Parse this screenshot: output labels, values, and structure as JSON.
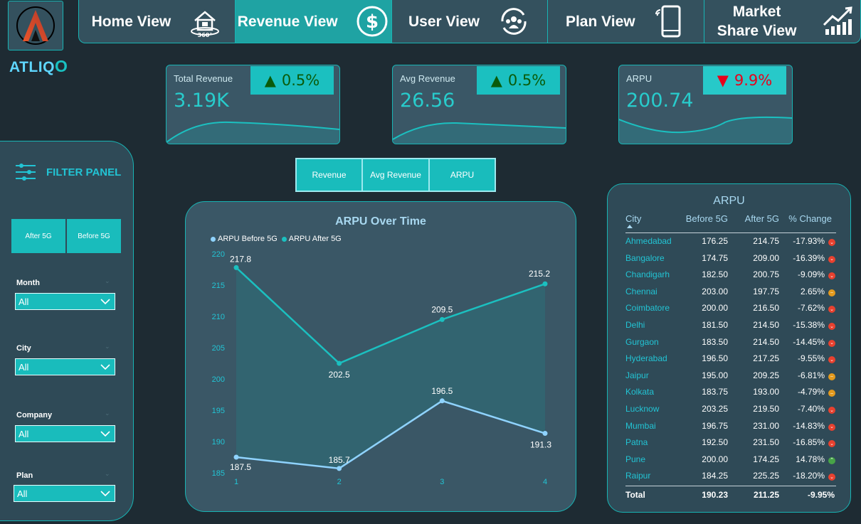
{
  "brand": {
    "name_prefix": "ATLIQ",
    "name_suffix": "O",
    "logo_letter": "A"
  },
  "nav": {
    "tabs": [
      {
        "label": "Home View",
        "icon": "house-360-icon",
        "active": false
      },
      {
        "label": "Revenue View",
        "icon": "dollar-icon",
        "active": true
      },
      {
        "label": "User View",
        "icon": "users-cycle-icon",
        "active": false
      },
      {
        "label": "Plan View",
        "icon": "smartphone-icon",
        "active": false
      },
      {
        "label": "Market Share View",
        "icon": "growth-chart-icon",
        "active": false
      }
    ]
  },
  "kpis": [
    {
      "title": "Total Revenue",
      "value": "3.19K",
      "change": "0.5%",
      "direction": "up"
    },
    {
      "title": "Avg Revenue",
      "value": "26.56",
      "change": "0.5%",
      "direction": "up"
    },
    {
      "title": "ARPU",
      "value": "200.74",
      "change": "9.9%",
      "direction": "down"
    }
  ],
  "colors": {
    "accent": "#19bcbc",
    "teal_line": "#1bc0c0",
    "light_blue_line": "#8fd3fe",
    "up": "#0a5b0a",
    "down": "#e8001a",
    "background": "#1e2b33",
    "card": "#3a5766"
  },
  "filter_panel": {
    "title": "FILTER PANEL",
    "toggle": [
      "After 5G",
      "Before 5G"
    ],
    "filters": [
      {
        "label": "Month",
        "value": "All"
      },
      {
        "label": "City",
        "value": "All"
      },
      {
        "label": "Company",
        "value": "All"
      },
      {
        "label": "Plan",
        "value": "All"
      }
    ]
  },
  "metric_buttons": [
    "Revenue",
    "Avg Revenue",
    "ARPU"
  ],
  "chart_data": {
    "type": "area",
    "title": "ARPU Over Time",
    "x": [
      1,
      2,
      3,
      4
    ],
    "ylim": [
      185,
      220
    ],
    "yticks": [
      185,
      190,
      195,
      200,
      205,
      210,
      215,
      220
    ],
    "series": [
      {
        "name": "ARPU Before 5G",
        "values": [
          187.5,
          185.7,
          196.5,
          191.3
        ],
        "labels": [
          "187.5",
          "185.7",
          "196.5",
          "191.3"
        ],
        "color": "#8fd3fe"
      },
      {
        "name": "ARPU After 5G",
        "values": [
          217.8,
          202.5,
          209.5,
          215.2
        ],
        "labels": [
          "217.8",
          "202.5",
          "209.5",
          "215.2"
        ],
        "color": "#1bc0c0"
      }
    ],
    "legend": "top-left",
    "grid": false
  },
  "table": {
    "title": "ARPU",
    "headers": [
      "City",
      "Before 5G",
      "After 5G",
      "% Change"
    ],
    "rows": [
      {
        "city": "Ahmedabad",
        "before": "176.25",
        "after": "214.75",
        "change": "-17.93%",
        "status": "down"
      },
      {
        "city": "Bangalore",
        "before": "174.75",
        "after": "209.00",
        "change": "-16.39%",
        "status": "down"
      },
      {
        "city": "Chandigarh",
        "before": "182.50",
        "after": "200.75",
        "change": "-9.09%",
        "status": "down"
      },
      {
        "city": "Chennai",
        "before": "203.00",
        "after": "197.75",
        "change": "2.65%",
        "status": "neutral"
      },
      {
        "city": "Coimbatore",
        "before": "200.00",
        "after": "216.50",
        "change": "-7.62%",
        "status": "down"
      },
      {
        "city": "Delhi",
        "before": "181.50",
        "after": "214.50",
        "change": "-15.38%",
        "status": "down"
      },
      {
        "city": "Gurgaon",
        "before": "183.50",
        "after": "214.50",
        "change": "-14.45%",
        "status": "down"
      },
      {
        "city": "Hyderabad",
        "before": "196.50",
        "after": "217.25",
        "change": "-9.55%",
        "status": "down"
      },
      {
        "city": "Jaipur",
        "before": "195.00",
        "after": "209.25",
        "change": "-6.81%",
        "status": "neutral"
      },
      {
        "city": "Kolkata",
        "before": "183.75",
        "after": "193.00",
        "change": "-4.79%",
        "status": "neutral"
      },
      {
        "city": "Lucknow",
        "before": "203.25",
        "after": "219.50",
        "change": "-7.40%",
        "status": "down"
      },
      {
        "city": "Mumbai",
        "before": "196.75",
        "after": "231.00",
        "change": "-14.83%",
        "status": "down"
      },
      {
        "city": "Patna",
        "before": "192.50",
        "after": "231.50",
        "change": "-16.85%",
        "status": "down"
      },
      {
        "city": "Pune",
        "before": "200.00",
        "after": "174.25",
        "change": "14.78%",
        "status": "up"
      },
      {
        "city": "Raipur",
        "before": "184.25",
        "after": "225.25",
        "change": "-18.20%",
        "status": "down"
      }
    ],
    "total": {
      "label": "Total",
      "before": "190.23",
      "after": "211.25",
      "change": "-9.95%"
    }
  }
}
